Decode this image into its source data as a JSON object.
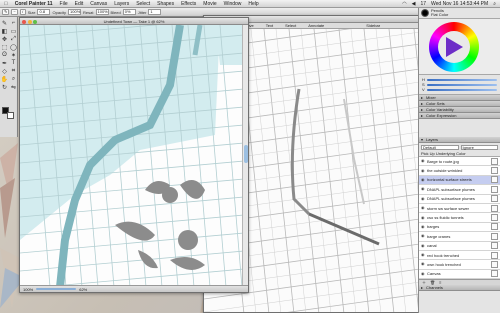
{
  "menubar": {
    "app_name": "Corel Painter 11",
    "items": [
      "File",
      "Edit",
      "Canvas",
      "Layers",
      "Select",
      "Shapes",
      "Effects",
      "Movie",
      "Window",
      "Help"
    ],
    "right": {
      "battery": "17",
      "datetime": "Wed Nov 16 14:53:44 PM"
    }
  },
  "propbar": {
    "fields": [
      "0.8",
      "100%",
      "100%",
      "0%",
      "1"
    ],
    "labels": [
      "Size",
      "Opacity",
      "Resat",
      "Bleed",
      "Jitter"
    ]
  },
  "doc1": {
    "title": "Undefined Town — Take 1 @ 62%",
    "status": "100%",
    "zoom": "62%"
  },
  "doc2": {
    "tools": [
      "Move",
      "Text",
      "Select",
      "Annotate"
    ],
    "side": "Sidebar"
  },
  "palettes": {
    "brush_selector": {
      "category": "Pencils",
      "variant": "Flat Color"
    },
    "color_sliders": [
      "H",
      "S",
      "V"
    ],
    "section_headers": [
      "Mixer",
      "Color Sets",
      "Color Variability",
      "Color Expression",
      "Layers"
    ],
    "layer_controls": {
      "composite": "Default",
      "method": "Ignore",
      "preserve": "Pick Up Underlying Color"
    },
    "layers": [
      "Barge to route.jpg",
      "the outside wrinkled",
      "horizontal surface streets",
      "DNAPL subsurface plumes",
      "DNAPL subsurface plumes",
      "storm sw surface sewer",
      "cso ss fluidic tunnels",
      "barges",
      "barge cranes",
      "canal",
      "red hook trenched",
      "own hook trenched",
      "Canvas"
    ],
    "selected_layer_index": 2,
    "footer_label": "Channels"
  }
}
